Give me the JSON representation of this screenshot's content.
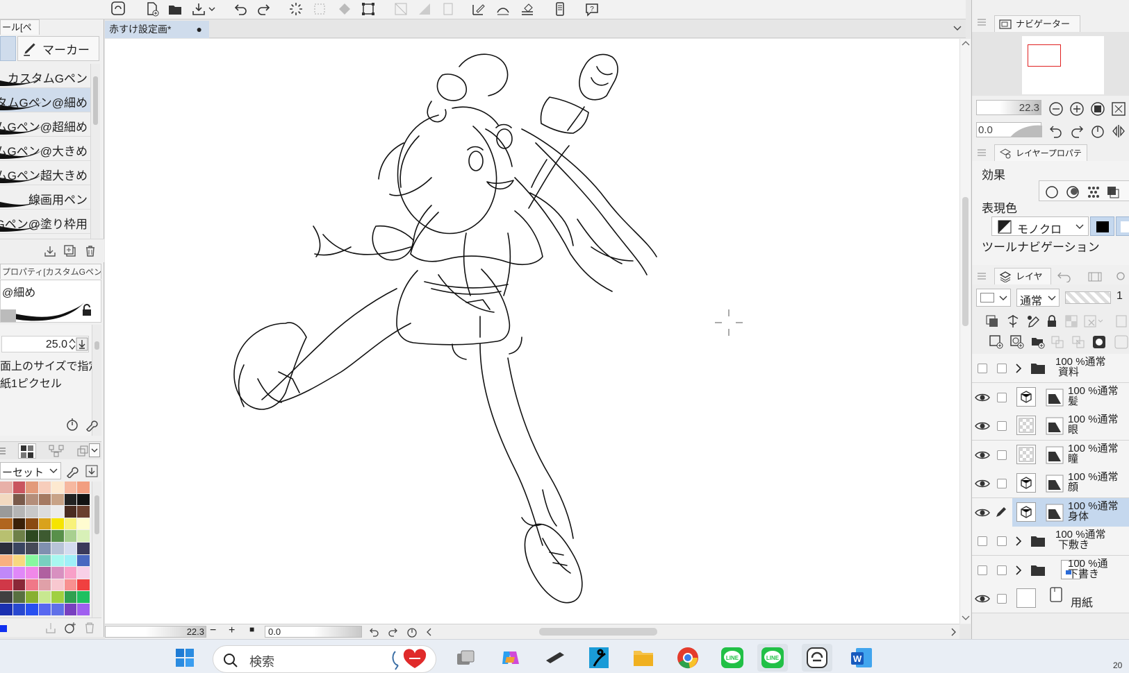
{
  "window": {
    "document_tab": "赤すけ設定画*",
    "canvas_zoom": "22.3",
    "canvas_rotation": "0.0"
  },
  "left_panel": {
    "tool_tab": "ール[ペン]",
    "sub_tool_marker": "マーカー",
    "brushes": [
      {
        "label": "カスタムGペン",
        "selected": false
      },
      {
        "label": "スタムGペン@細め",
        "selected": true
      },
      {
        "label": "ムGペン@超細め",
        "selected": false
      },
      {
        "label": "ムGペン@大きめ",
        "selected": false
      },
      {
        "label": "ムGペン超大きめ",
        "selected": false
      },
      {
        "label": "線画用ペン",
        "selected": false
      },
      {
        "label": "Gペン@塗り枠用",
        "selected": false
      }
    ],
    "tool_property_tab": "プロパティ[カスタムGペン@",
    "tool_property_name": "@細め",
    "brush_size": "25.0",
    "size_option_1": "面上のサイズで指定",
    "size_option_2": "紙1ピクセル",
    "color_set_select": "ーセット",
    "palette_colors": [
      [
        "#e8b0a8",
        "#c9555f",
        "#e39a7a",
        "#f7cdbb",
        "#fde9d0",
        "#f6b8a0",
        "#f29e80"
      ],
      [
        "#f2d9c0",
        "#7a5a4a",
        "#b48e7a",
        "#a57a62",
        "#c8a387",
        "#222222",
        "#121212"
      ],
      [
        "#9a9a9a",
        "#b5b5b5",
        "#c8c8c8",
        "#dcdcdc",
        "#ececec",
        "#4a2c20",
        "#6a3f2e"
      ],
      [
        "#b0651e",
        "#3a2008",
        "#8a4a12",
        "#d9a21c",
        "#f6e400",
        "#f8f27a",
        "#fffcd0"
      ],
      [
        "#b8c070",
        "#6e8048",
        "#2d4820",
        "#3d5a30",
        "#58904a",
        "#a8d090",
        "#d8f0b8"
      ],
      [
        "#2b2e3a",
        "#3a4560",
        "#464a58",
        "#8090b0",
        "#b8c4d8",
        "#d4dcef",
        "#3a3a5a"
      ],
      [
        "#f8b080",
        "#f8d880",
        "#88f8a0",
        "#78d0c0",
        "#a8f8f0",
        "#a0f0f8",
        "#4868c0"
      ],
      [
        "#c088f8",
        "#e088f8",
        "#f088e8",
        "#b060a0",
        "#d890c0",
        "#f8a0c8",
        "#f8d0e8"
      ],
      [
        "#d03848",
        "#8a2838",
        "#f07888",
        "#e0a0a8",
        "#f8c8d0",
        "#f89090",
        "#f04040"
      ],
      [
        "#404040",
        "#587040",
        "#88b030",
        "#c8e890",
        "#a0d040",
        "#30a050",
        "#20c060"
      ],
      [
        "#1a30b0",
        "#2848d0",
        "#2850f0",
        "#5868f0",
        "#6070e8",
        "#7840c0",
        "#a060f0"
      ]
    ]
  },
  "right_panel": {
    "navigator_tab": "ナビゲーター",
    "nav_zoom": "22.3",
    "nav_rotation": "0.0",
    "layer_property_tab": "レイヤープロパティ",
    "effect_label": "効果",
    "expression_color_label": "表現色",
    "expression_color_value": "モノクロ",
    "tool_nav_label": "ツールナビゲーション",
    "layer_tab": "レイヤー",
    "blend_mode": "通常",
    "opacity_partial": "1",
    "layers": [
      {
        "mode": "100 %通常",
        "name": "資料",
        "visible": false,
        "kind": "folder",
        "selected": false
      },
      {
        "mode": "100 %通常",
        "name": "髪",
        "visible": true,
        "kind": "vector",
        "selected": false
      },
      {
        "mode": "100 %通常",
        "name": "眼",
        "visible": true,
        "kind": "raster",
        "selected": false
      },
      {
        "mode": "100 %通常",
        "name": "瞳",
        "visible": true,
        "kind": "raster",
        "selected": false
      },
      {
        "mode": "100 %通常",
        "name": "顔",
        "visible": true,
        "kind": "vector",
        "selected": false
      },
      {
        "mode": "100 %通常",
        "name": "身体",
        "visible": true,
        "kind": "vector",
        "selected": true
      },
      {
        "mode": "100 %通常",
        "name": "下敷き",
        "visible": false,
        "kind": "folder",
        "selected": false
      },
      {
        "mode": "100 %通",
        "name": "下書き",
        "visible": false,
        "kind": "folder",
        "selected": false
      },
      {
        "mode": "",
        "name": "用紙",
        "visible": true,
        "kind": "paper",
        "selected": false
      }
    ]
  },
  "taskbar": {
    "search_placeholder": "検索",
    "clock_partial": "20"
  }
}
